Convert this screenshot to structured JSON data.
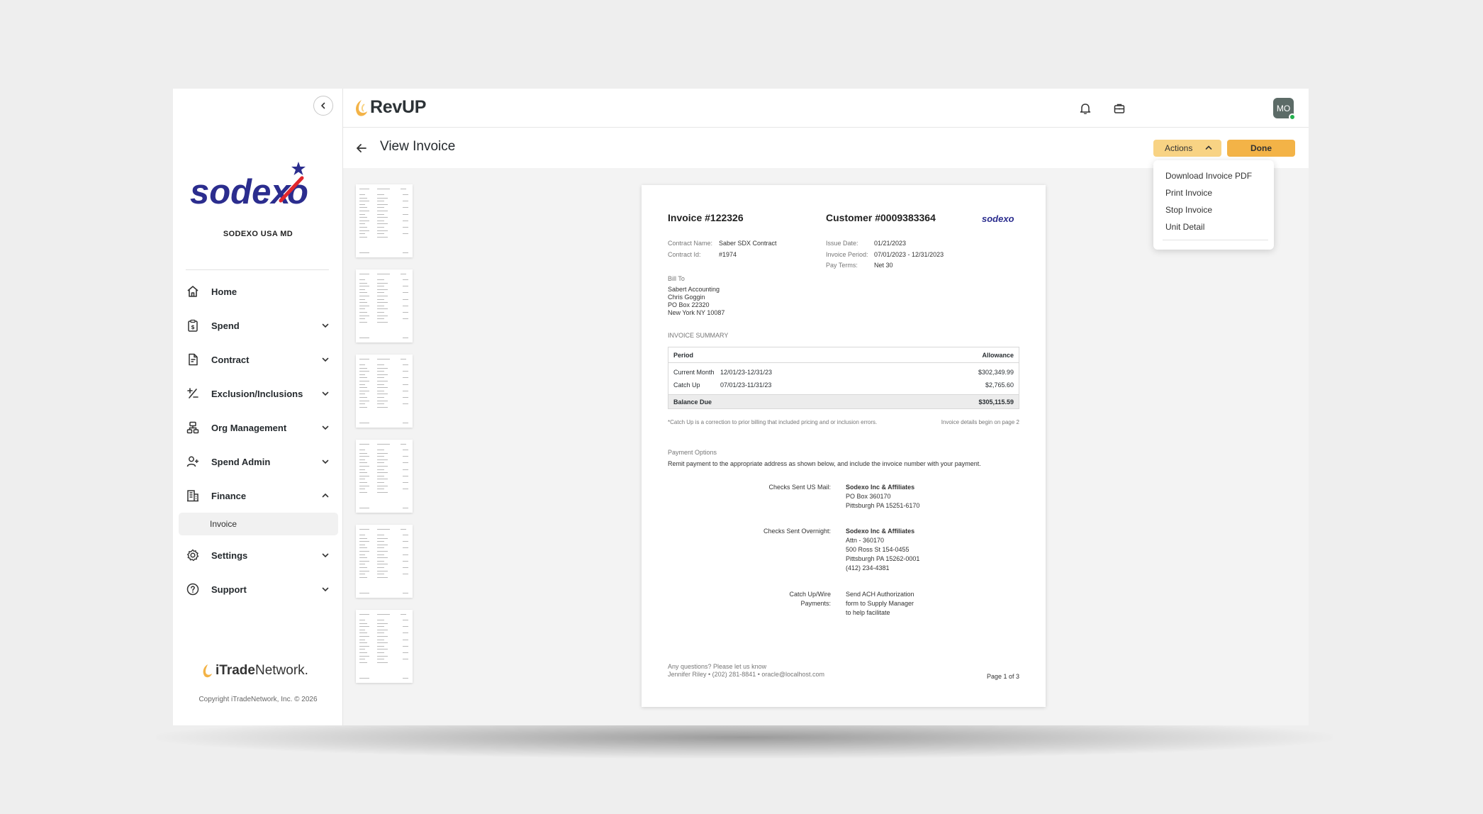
{
  "sidebar": {
    "org_name": "SODEXO USA MD",
    "logo_text": "sodexo",
    "nav": {
      "home": "Home",
      "spend": "Spend",
      "contract": "Contract",
      "exclusions": "Exclusion/Inclusions",
      "org_management": "Org Management",
      "spend_admin": "Spend Admin",
      "finance": "Finance",
      "invoice": "Invoice",
      "settings": "Settings",
      "support": "Support"
    },
    "footer_brand_bold": "iTrade",
    "footer_brand_rest": "Network.",
    "copyright": "Copyright iTradeNetwork, Inc. © 2026"
  },
  "topbar": {
    "app_name": "RevUP",
    "avatar_initials": "MO"
  },
  "page": {
    "title": "View Invoice",
    "actions_label": "Actions",
    "done_label": "Done"
  },
  "actions_menu": [
    "Download Invoice PDF",
    "Print Invoice",
    "Stop Invoice",
    "Unit Detail"
  ],
  "invoice": {
    "number": "Invoice #122326",
    "customer": "Customer #0009383364",
    "logo": "sodexo",
    "contract_name_label": "Contract Name:",
    "contract_name": "Saber SDX Contract",
    "contract_id_label": "Contract Id:",
    "contract_id": "#1974",
    "issue_date_label": "Issue Date:",
    "issue_date": "01/21/2023",
    "invoice_period_label": "Invoice Period:",
    "invoice_period": "07/01/2023 - 12/31/2023",
    "pay_terms_label": "Pay Terms:",
    "pay_terms": "Net 30",
    "bill_to_label": "Bill To",
    "bill_to": [
      "Sabert Accounting",
      "Chris Goggin",
      "PO Box 22320",
      "New York NY 10087"
    ],
    "summary_label": "INVOICE SUMMARY",
    "summary": {
      "col_period": "Period",
      "col_allowance": "Allowance",
      "rows": [
        {
          "name": "Current Month",
          "period": "12/01/23-12/31/23",
          "amount": "$302,349.99"
        },
        {
          "name": "Catch Up",
          "period": "07/01/23-11/31/23",
          "amount": "$2,765.60"
        }
      ],
      "balance_label": "Balance Due",
      "balance": "$305,115.59"
    },
    "catchup_note": "*Catch Up is a correction to prior billing that included pricing and or inclusion errors.",
    "details_note": "Invoice details begin on page 2",
    "payment_options_label": "Payment Options",
    "payment_instruction": "Remit payment to the appropriate address as shown below, and include the invoice number with your payment.",
    "mail_label": "Checks Sent US Mail:",
    "mail_lines": [
      "Sodexo Inc & Affiliates",
      "PO Box 360170",
      "Pittsburgh PA 15251-6170"
    ],
    "overnight_label": "Checks Sent Overnight:",
    "overnight_lines": [
      "Sodexo Inc & Affiliates",
      "Attn - 360170",
      "500 Ross St 154-0455",
      "Pittsburgh PA 15262-0001",
      "(412) 234-4381"
    ],
    "wire_label_1": "Catch Up/Wire",
    "wire_label_2": "Payments:",
    "wire_lines": [
      "Send ACH Authorization",
      "form to Supply Manager",
      "to help facilitate"
    ],
    "questions": "Any questions? Please let us know",
    "contact": "Jennifer Riley • (202) 281-8841 • oracle@localhost.com",
    "page_num": "Page 1 of 3"
  },
  "colors": {
    "actions_button": "#f8d384",
    "done_button": "#f3b347",
    "brand_blue": "#2b2d8e",
    "brand_red": "#e1262d",
    "avatar": "#5c6b67",
    "status_online": "#23b14d"
  }
}
